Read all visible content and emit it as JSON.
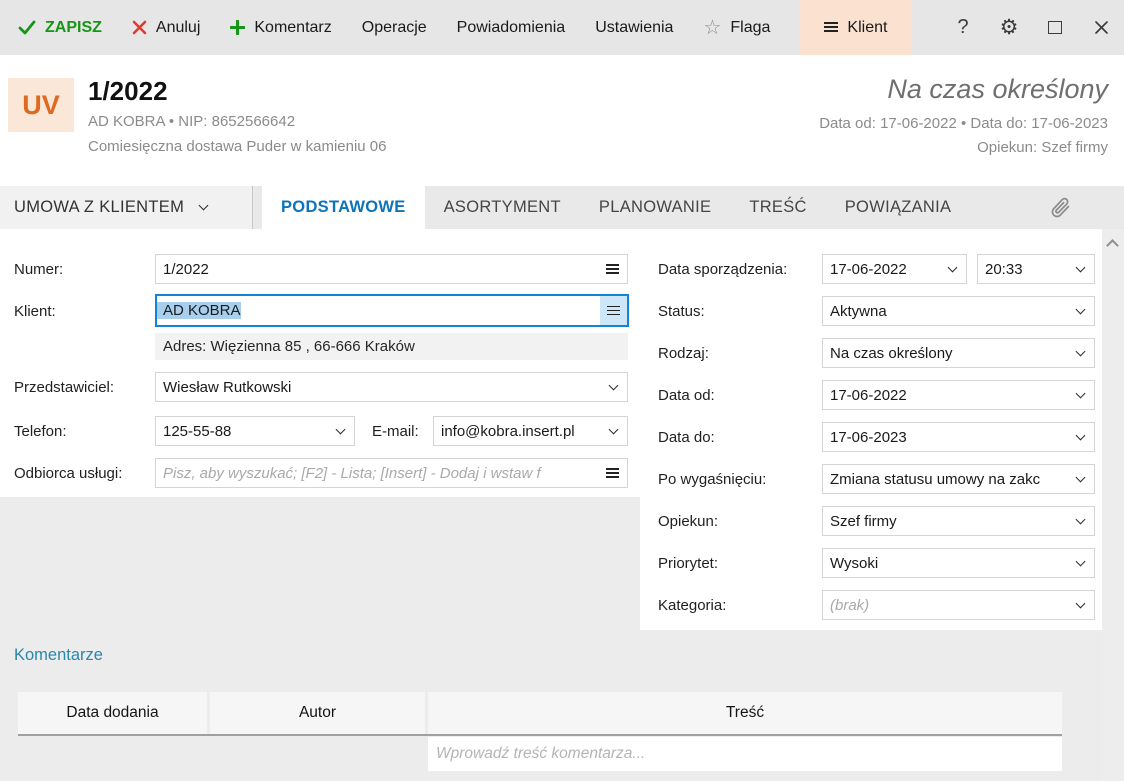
{
  "toolbar": {
    "save": "ZAPISZ",
    "cancel": "Anuluj",
    "add_comment": "Komentarz",
    "operations": "Operacje",
    "notifications": "Powiadomienia",
    "settings": "Ustawienia",
    "flag": "Flaga",
    "client": "Klient",
    "help": "?"
  },
  "colors": {
    "accent_green": "#169616",
    "accent_red": "#e23a2e",
    "client_button_bg": "#fbe2d0",
    "badge_text": "#dd6a20",
    "active_tab_blue": "#0c74b8",
    "selection_blue": "#a8d0ee",
    "focus_border": "#1583d5",
    "comments_heading": "#2b86ac"
  },
  "header": {
    "badge": "UV",
    "title": "1/2022",
    "subtitle": "AD KOBRA  •  NIP: 8652566642",
    "description": "Comiesięczna dostawa Puder w kamieniu 06",
    "contract_type": "Na czas określony",
    "date_range": "Data od: 17-06-2022  •  Data do: 17-06-2023",
    "caretaker": "Opiekun: Szef firmy"
  },
  "tabs": {
    "menu_label": "UMOWA Z KLIENTEM",
    "items": [
      {
        "label": "PODSTAWOWE",
        "active": true
      },
      {
        "label": "ASORTYMENT",
        "active": false
      },
      {
        "label": "PLANOWANIE",
        "active": false
      },
      {
        "label": "TREŚĆ",
        "active": false
      },
      {
        "label": "POWIĄZANIA",
        "active": false
      }
    ]
  },
  "form": {
    "numer": {
      "label": "Numer:",
      "value": "1/2022"
    },
    "klient": {
      "label": "Klient:",
      "value": "AD KOBRA",
      "address": "Adres:  Więzienna  85 , 66-666 Kraków"
    },
    "przedstawiciel": {
      "label": "Przedstawiciel:",
      "value": "Wiesław Rutkowski"
    },
    "telefon": {
      "label": "Telefon:",
      "value": "125-55-88"
    },
    "email": {
      "label": "E-mail:",
      "value": "info@kobra.insert.pl"
    },
    "odbiorca": {
      "label": "Odbiorca usługi:",
      "placeholder": "Pisz, aby wyszukać; [F2] - Lista; [Insert] - Dodaj i wstaw f"
    },
    "data_sporzadzenia": {
      "label": "Data sporządzenia:",
      "date": "17-06-2022",
      "time": "20:33"
    },
    "status": {
      "label": "Status:",
      "value": "Aktywna"
    },
    "rodzaj": {
      "label": "Rodzaj:",
      "value": "Na czas określony"
    },
    "data_od": {
      "label": "Data od:",
      "value": "17-06-2022"
    },
    "data_do": {
      "label": "Data do:",
      "value": "17-06-2023"
    },
    "po_wygasnieciu": {
      "label": "Po wygaśnięciu:",
      "value": "Zmiana statusu umowy na zakc"
    },
    "opiekun": {
      "label": "Opiekun:",
      "value": "Szef firmy"
    },
    "priorytet": {
      "label": "Priorytet:",
      "value": "Wysoki"
    },
    "kategoria": {
      "label": "Kategoria:",
      "placeholder": "(brak)"
    }
  },
  "comments": {
    "heading": "Komentarze",
    "columns": [
      "Data dodania",
      "Autor",
      "Treść"
    ],
    "input_placeholder": "Wprowadź treść komentarza..."
  }
}
